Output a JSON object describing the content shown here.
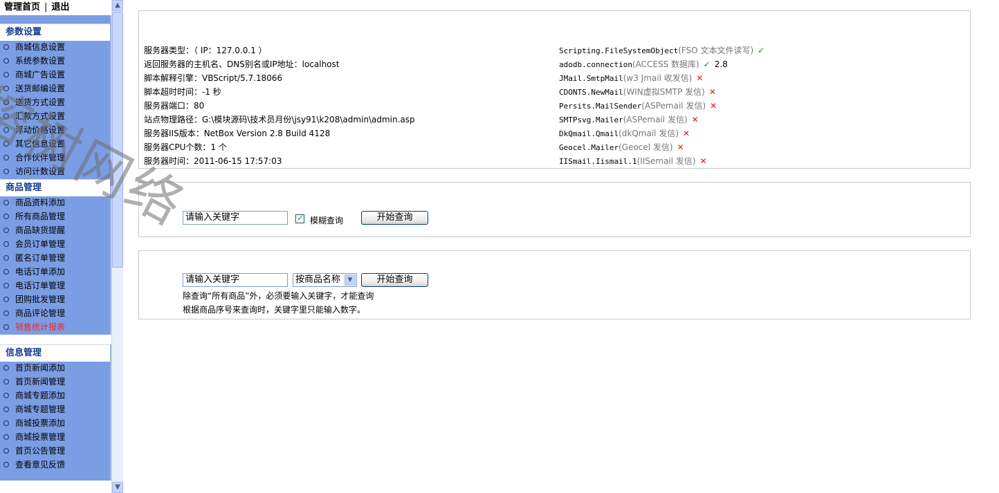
{
  "top_links": {
    "home": "管理首页",
    "separator": "|",
    "logout": "退出"
  },
  "nav": [
    {
      "title": "参数设置",
      "items": [
        "商城信息设置",
        "系统参数设置",
        "商城广告设置",
        "送货邮编设置",
        "送货方式设置",
        "汇款方式设置",
        "浮动价格设置",
        "其它信息设置",
        "合作伙伴管理",
        "访问计数设置"
      ]
    },
    {
      "title": "商品管理",
      "items": [
        "商品资料添加",
        "所有商品管理",
        "商品缺货提醒",
        "会员订单管理",
        "匿名订单管理",
        "电话订单添加",
        "电话订单管理",
        "团购批发管理",
        "商品评论管理",
        "销售统计报表"
      ]
    },
    {
      "title": "信息管理",
      "items": [
        "首页新闻添加",
        "首页新闻管理",
        "商城专题添加",
        "商城专题管理",
        "商城投票添加",
        "商城投票管理",
        "首页公告管理",
        "查看意见反馈"
      ]
    }
  ],
  "highlight_color": "#ff2020",
  "server_info": {
    "left": [
      "服务器类型：（ IP：127.0.0.1 ）",
      "返回服务器的主机名、DNS别名或IP地址：localhost",
      "脚本解释引擎：VBScript/5.7.18066",
      "脚本超时时间：-1 秒",
      "服务器端口：80",
      "站点物理路径：G:\\模块源码\\技术员月份\\jsy91\\k208\\admin\\admin.asp",
      "服务器IIS版本：NetBox Version 2.8 Build 4128",
      "服务器CPU个数：1 个",
      "服务器时间：2011-06-15 17:57:03"
    ],
    "right": [
      {
        "name": "Scripting.FileSystemObject",
        "desc": "(FSO 文本文件读写)",
        "status": "✓",
        "extra": ""
      },
      {
        "name": "adodb.connection",
        "desc": "(ACCESS 数据库)",
        "status": "✓",
        "extra": "2.8"
      },
      {
        "name": "JMail.SmtpMail",
        "desc": "(w3 Jmail 收发信)",
        "status": "✕",
        "extra": ""
      },
      {
        "name": "CDONTS.NewMail",
        "desc": "(WIN虚拟SMTP 发信)",
        "status": "✕",
        "extra": ""
      },
      {
        "name": "Persits.MailSender",
        "desc": "(ASPemail 发信)",
        "status": "✕",
        "extra": ""
      },
      {
        "name": "SMTPsvg.Mailer",
        "desc": "(ASPemail 发信)",
        "status": "✕",
        "extra": ""
      },
      {
        "name": "DkQmail.Qmail",
        "desc": "(dkQmail 发信)",
        "status": "✕",
        "extra": ""
      },
      {
        "name": "Geocel.Mailer",
        "desc": "(Geocel 发信)",
        "status": "✕",
        "extra": ""
      },
      {
        "name": "IISmail.Iismail.1",
        "desc": "(IISemail 发信)",
        "status": "✕",
        "extra": ""
      }
    ]
  },
  "search1": {
    "value": "请输入关键字",
    "fuzzy_label": "模糊查询",
    "fuzzy_checked": true,
    "button": "开始查询"
  },
  "search2": {
    "value": "请输入关键字",
    "select_value": "按商品名称",
    "button": "开始查询",
    "note1": "除查询“所有商品”外，必须要输入关键字，才能查询",
    "note2": "根据商品序号来查询时，关键字里只能输入数字。"
  },
  "watermark": "榕树网络"
}
